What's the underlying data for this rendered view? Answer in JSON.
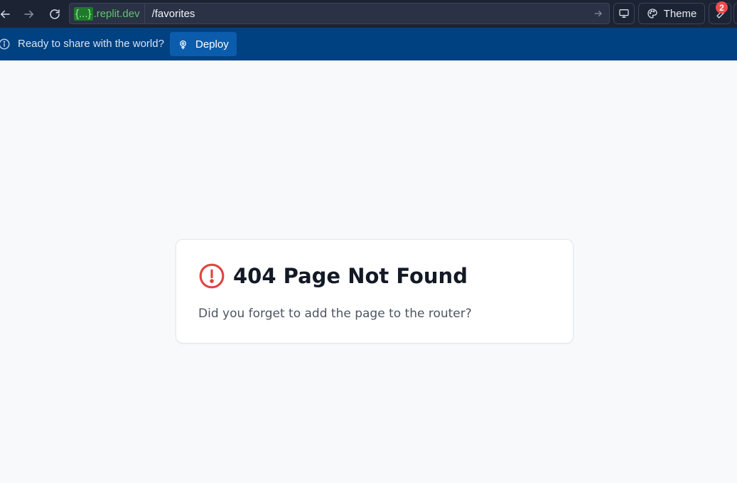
{
  "browser": {
    "url_host_braces": "{...}",
    "url_host_domain": ".replit.dev",
    "url_path": "/favorites",
    "theme_label": "Theme",
    "notification_count": "2",
    "icons": {
      "back": "arrow-left-icon",
      "forward": "arrow-right-icon",
      "reload": "reload-icon",
      "go": "arrow-right-icon",
      "devices": "monitor-icon",
      "theme": "palette-icon",
      "tools": "wrench-icon"
    }
  },
  "banner": {
    "text": "Ready to share with the world?",
    "deploy_label": "Deploy",
    "icons": {
      "info": "info-icon",
      "deploy": "deploy-icon"
    },
    "colors": {
      "background": "#004182",
      "button": "#0b5cad"
    }
  },
  "error_card": {
    "title": "404 Page Not Found",
    "message": "Did you forget to add the page to the router?",
    "icon": "alert-circle-icon",
    "colors": {
      "icon": "#e04545",
      "title": "#131a26",
      "text": "#4b5563"
    }
  }
}
